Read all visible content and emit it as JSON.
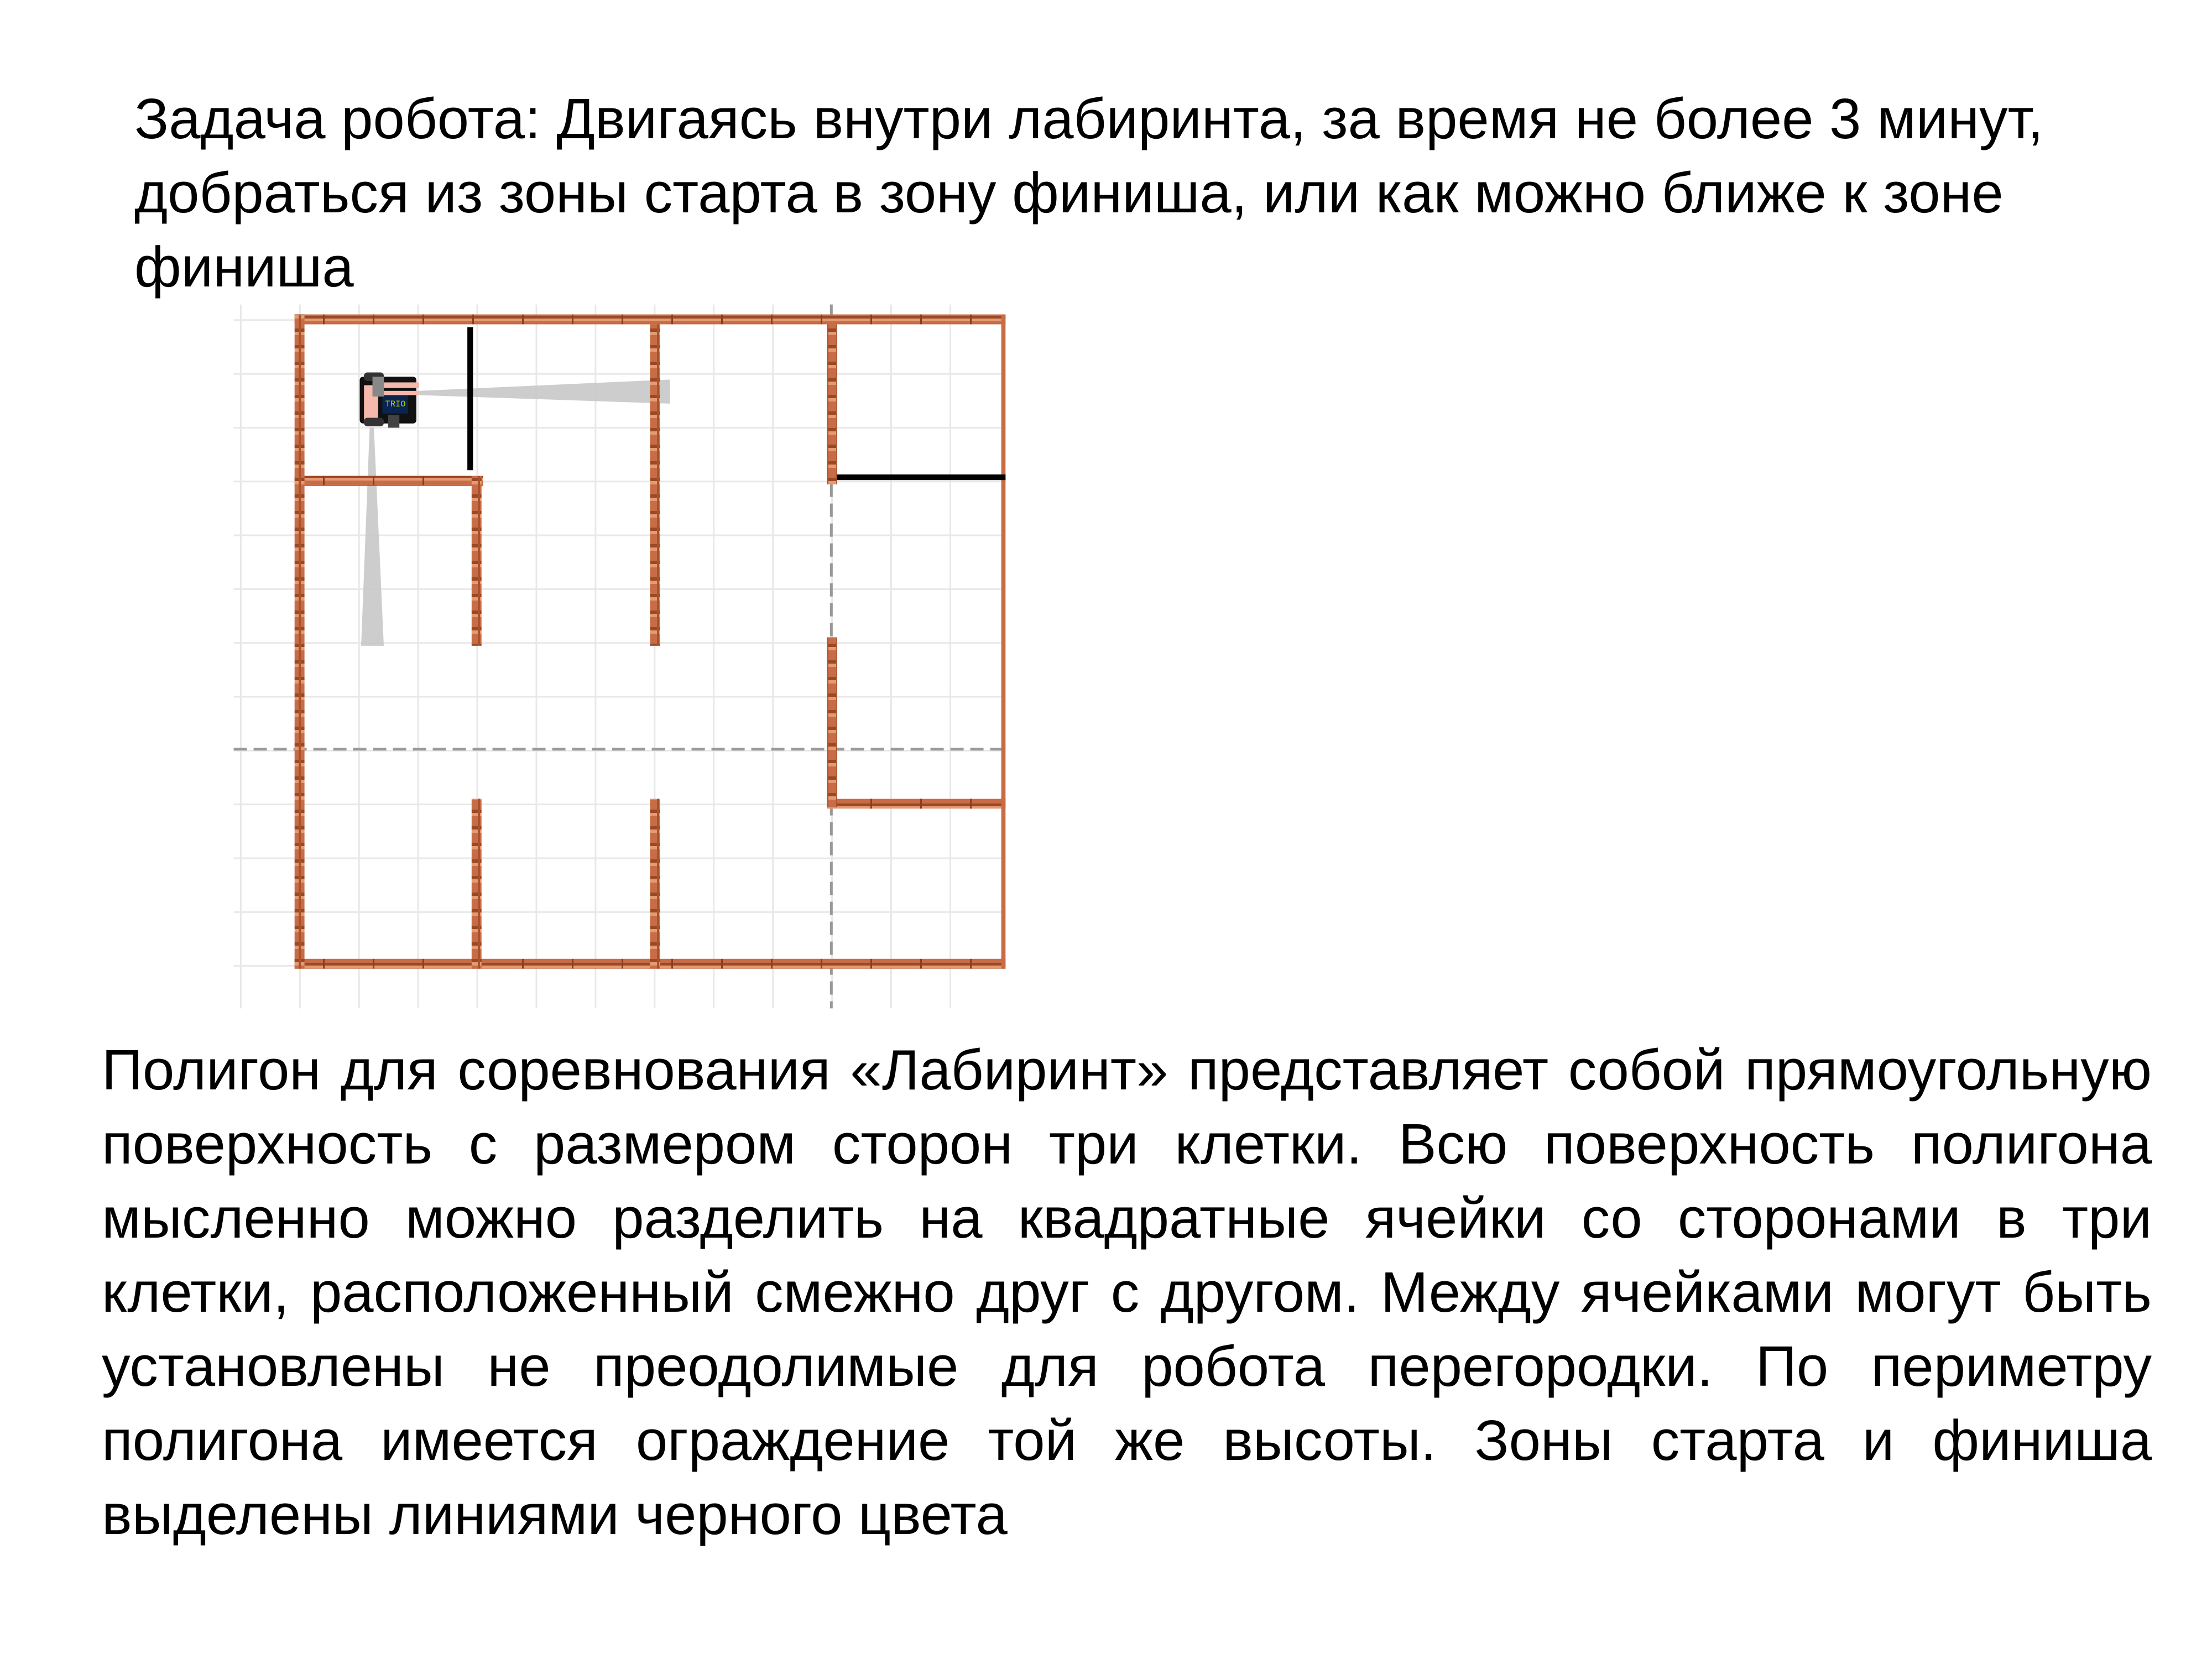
{
  "task_text": "Задача робота: Двигаясь внутри лабиринта, за время не более 3 минут, добраться из зоны старта в зону финиша, или как можно ближе к зоне финиша",
  "description_text": "Полигон для соревнования «Лабиринт» представляет собой прямоугольную поверхность с размером сторон три клетки. Всю поверхность полигона мысленно можно разделить на квадратные ячейки со сторонами в три клетки, расположенный смежно друг с другом. Между ячейками могут быть установлены не преодолимые для робота перегородки. По периметру полигона имеется ограждение той же высоты. Зоны старта и финиша выделены линиями черного цвета",
  "maze": {
    "wall_color": "#b8603a",
    "wall_highlight": "#e08a62",
    "zone_line_color": "#000000",
    "grid_color": "#e8e8e8",
    "axis_color": "#999999",
    "start_zone": "top-left cell",
    "finish_zone": "top-right cell"
  },
  "robot": {
    "icon": "robot-icon",
    "display_label": "TRIO"
  }
}
